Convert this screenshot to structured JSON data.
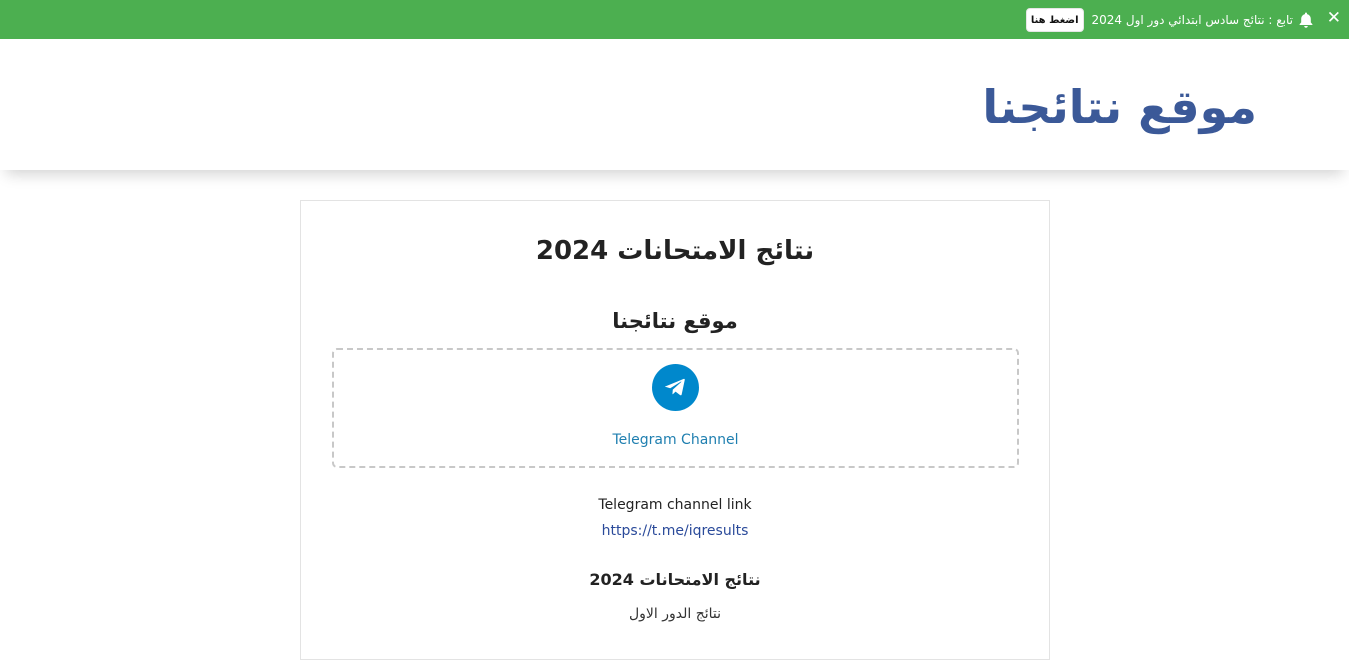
{
  "topbar": {
    "close_symbol": "✕",
    "bell_icon": "bell-icon",
    "text": "تابع : نتائج سادس ابتدائي دور اول 2024",
    "button_label": "اضغط هنا",
    "background_color": "#4caf50"
  },
  "header": {
    "site_title": "موقع نتائجنا",
    "title_color": "#3b5998"
  },
  "card": {
    "title": "نتائج الامتحانات 2024",
    "subtitle": "موقع نتائجنا",
    "telegram": {
      "icon": "telegram-icon",
      "label": "Telegram Channel",
      "color": "#0088cc"
    },
    "link_label": "Telegram channel link",
    "link_url": "https://t.me/iqresults",
    "section_title": "نتائج الامتحانات 2024",
    "section_item": "نتائج الدور الاول"
  }
}
